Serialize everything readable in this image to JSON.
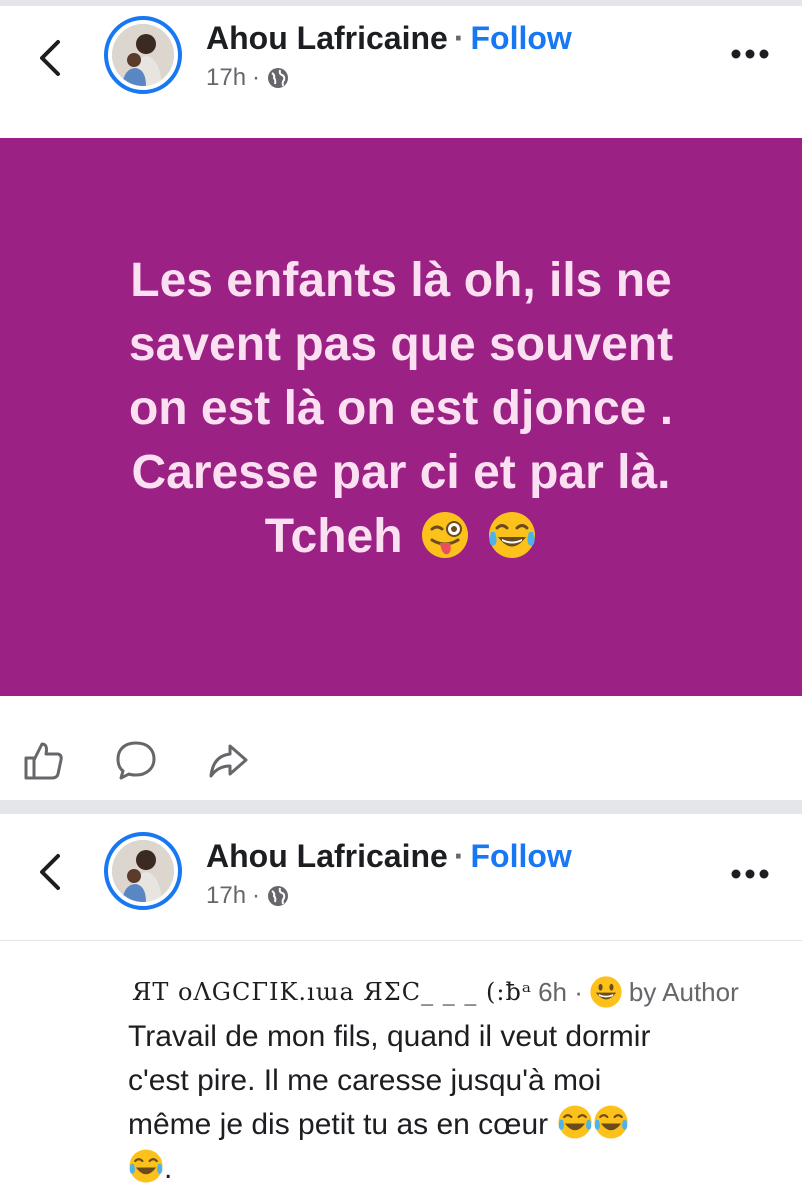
{
  "post1": {
    "author": "Ahou Lafricaine",
    "separator": "·",
    "follow_label": "Follow",
    "time": "17h",
    "text_lines": [
      "Les enfants là oh, ils ne",
      "savent pas que souvent",
      "on est là on est djonce .",
      "Caresse par ci et par là.",
      "Tcheh"
    ],
    "background_color": "#9b2185",
    "text_color": "#fbe0f2",
    "actions": [
      "like-icon",
      "comment-icon",
      "share-icon"
    ]
  },
  "post2": {
    "author": "Ahou Lafricaine",
    "separator": "·",
    "follow_label": "Follow",
    "time": "17h"
  },
  "comment": {
    "author_obscured": "ЯΤ оΛGϹΓΙΚ.ıɯa ЯΣϹ_ _ _ (:ƀᵃ",
    "time": "6h ·",
    "author_badge": "by Author",
    "text_lines": [
      "Travail de mon fils, quand il veut dormir",
      "c'est pire. Il me caresse jusqu'à moi",
      "même je dis petit tu as en cœur"
    ],
    "text_end": "."
  },
  "colors": {
    "accent": "#1877f2",
    "muted": "#65676b",
    "separator": "#e4e6eb"
  }
}
